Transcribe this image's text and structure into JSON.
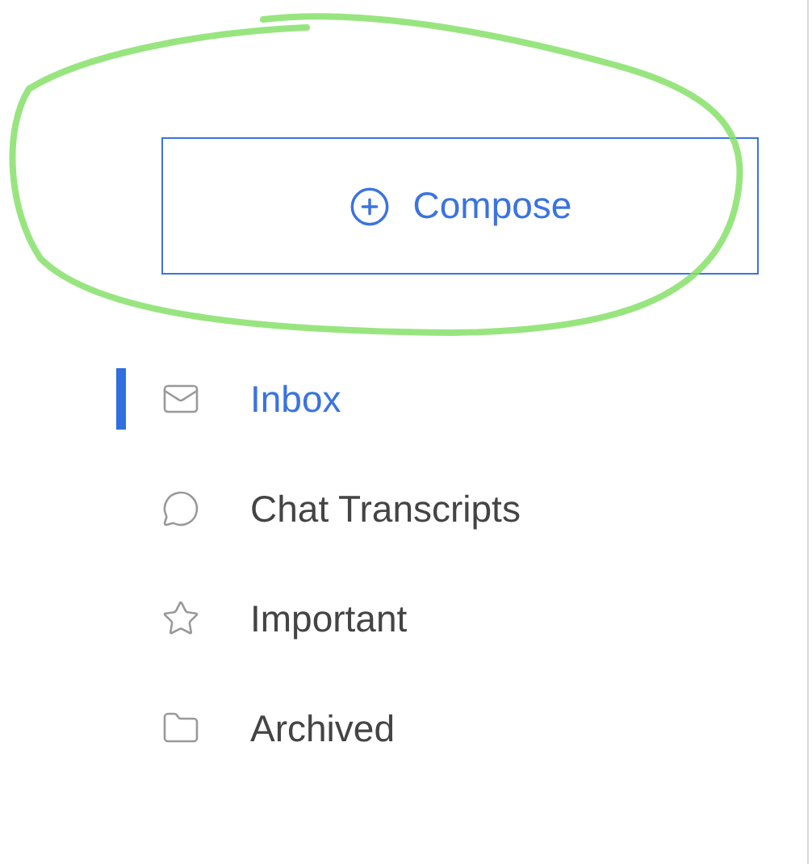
{
  "compose_button": {
    "label": "Compose"
  },
  "nav": [
    {
      "label": "Inbox",
      "selected": true
    },
    {
      "label": "Chat Transcripts",
      "selected": false
    },
    {
      "label": "Important",
      "selected": false
    },
    {
      "label": "Archived",
      "selected": false
    }
  ]
}
